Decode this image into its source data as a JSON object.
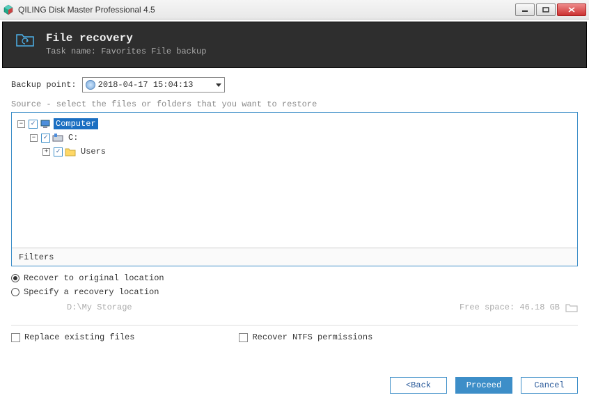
{
  "window": {
    "title": "QILING Disk Master Professional 4.5"
  },
  "header": {
    "title": "File recovery",
    "task_label": "Task name:",
    "task_name": "Favorites File backup"
  },
  "backup_point": {
    "label": "Backup point:",
    "value": "2018-04-17 15:04:13"
  },
  "source": {
    "label": "Source - select the files or folders that you want to restore",
    "tree": {
      "root": {
        "label": "Computer",
        "checked": true,
        "expanded": true,
        "selected": true
      },
      "drive": {
        "label": "C:",
        "checked": true,
        "expanded": true
      },
      "folder": {
        "label": "Users",
        "checked": true,
        "expanded": false
      }
    },
    "filters_label": "Filters"
  },
  "recovery": {
    "opt_original": "Recover to original location",
    "opt_specify": "Specify a recovery location",
    "selected": "original",
    "path": "D:\\My Storage",
    "free_space_label": "Free space:",
    "free_space_value": "46.18 GB"
  },
  "options": {
    "replace_existing": "Replace existing files",
    "recover_ntfs": "Recover NTFS permissions"
  },
  "buttons": {
    "back": "<Back",
    "proceed": "Proceed",
    "cancel": "Cancel"
  }
}
